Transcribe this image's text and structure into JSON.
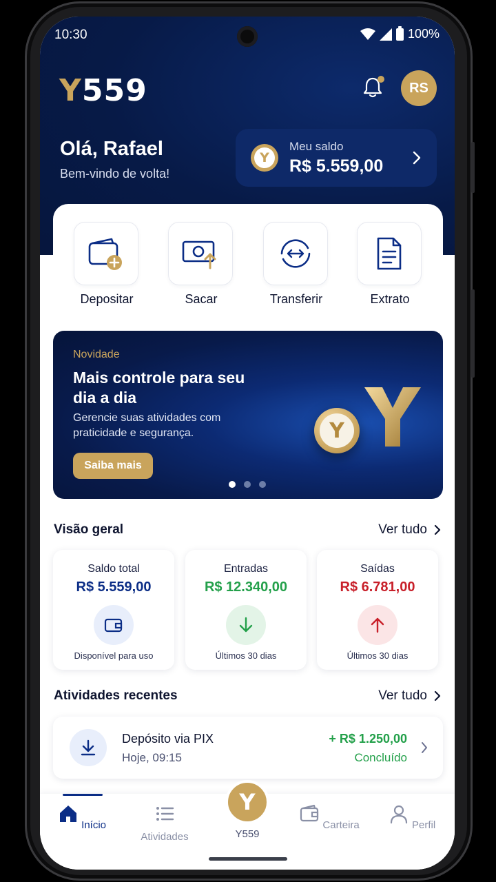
{
  "status_bar": {
    "time": "10:30",
    "battery": "100%"
  },
  "header": {
    "logo_y": "Y",
    "logo_rest": "559",
    "avatar_initials": "RS",
    "greeting": "Olá, Rafael",
    "welcome": "Bem-vindo de volta!",
    "balance_coin": "Y",
    "balance_label": "Meu saldo",
    "balance_value": "R$ 5.559,00"
  },
  "actions": [
    {
      "label": "Depositar",
      "icon": "wallet-plus-icon"
    },
    {
      "label": "Sacar",
      "icon": "cash-withdraw-icon"
    },
    {
      "label": "Transferir",
      "icon": "transfer-icon"
    },
    {
      "label": "Extrato",
      "icon": "document-icon"
    }
  ],
  "banner": {
    "eyebrow": "Novidade",
    "title": "Mais controle para seu dia a dia",
    "text": "Gerencie suas atividades com praticidade e segurança.",
    "button": "Saiba mais",
    "coin": "Y",
    "slides": 3,
    "active_slide": 1
  },
  "overview": {
    "title": "Visão geral",
    "see_all": "Ver tudo",
    "cards": [
      {
        "label": "Saldo total",
        "value": "R$ 5.559,00",
        "sub": "Disponível para uso",
        "color": "#0b2d86",
        "icon": "wallet-icon",
        "icon_bg": "#e8eefb"
      },
      {
        "label": "Entradas",
        "value": "R$ 12.340,00",
        "sub": "Últimos 30 dias",
        "color": "#23a04a",
        "icon": "arrow-down-icon",
        "icon_bg": "#e3f4e7"
      },
      {
        "label": "Saídas",
        "value": "R$ 6.781,00",
        "sub": "Últimos 30 dias",
        "color": "#c8202a",
        "icon": "arrow-up-icon",
        "icon_bg": "#fbe5e6"
      }
    ]
  },
  "activities": {
    "title": "Atividades recentes",
    "see_all": "Ver tudo",
    "items": [
      {
        "title": "Depósito via PIX",
        "time": "Hoje, 09:15",
        "amount": "+ R$ 1.250,00",
        "status": "Concluído",
        "icon": "download-icon"
      }
    ]
  },
  "bottom_nav": {
    "items": [
      {
        "label": "Início",
        "icon": "home-icon",
        "active": true
      },
      {
        "label": "Atividades",
        "icon": "list-icon",
        "active": false
      },
      {
        "label": "Y559",
        "icon": "y559-logo-icon",
        "active": false
      },
      {
        "label": "Carteira",
        "icon": "wallet-icon",
        "active": false
      },
      {
        "label": "Perfil",
        "icon": "user-icon",
        "active": false
      }
    ],
    "center_glyph": "Y"
  },
  "colors": {
    "navy": "#071a47",
    "gold": "#c9a45c",
    "primary": "#0b2d86",
    "green": "#23a04a",
    "red": "#c8202a"
  }
}
